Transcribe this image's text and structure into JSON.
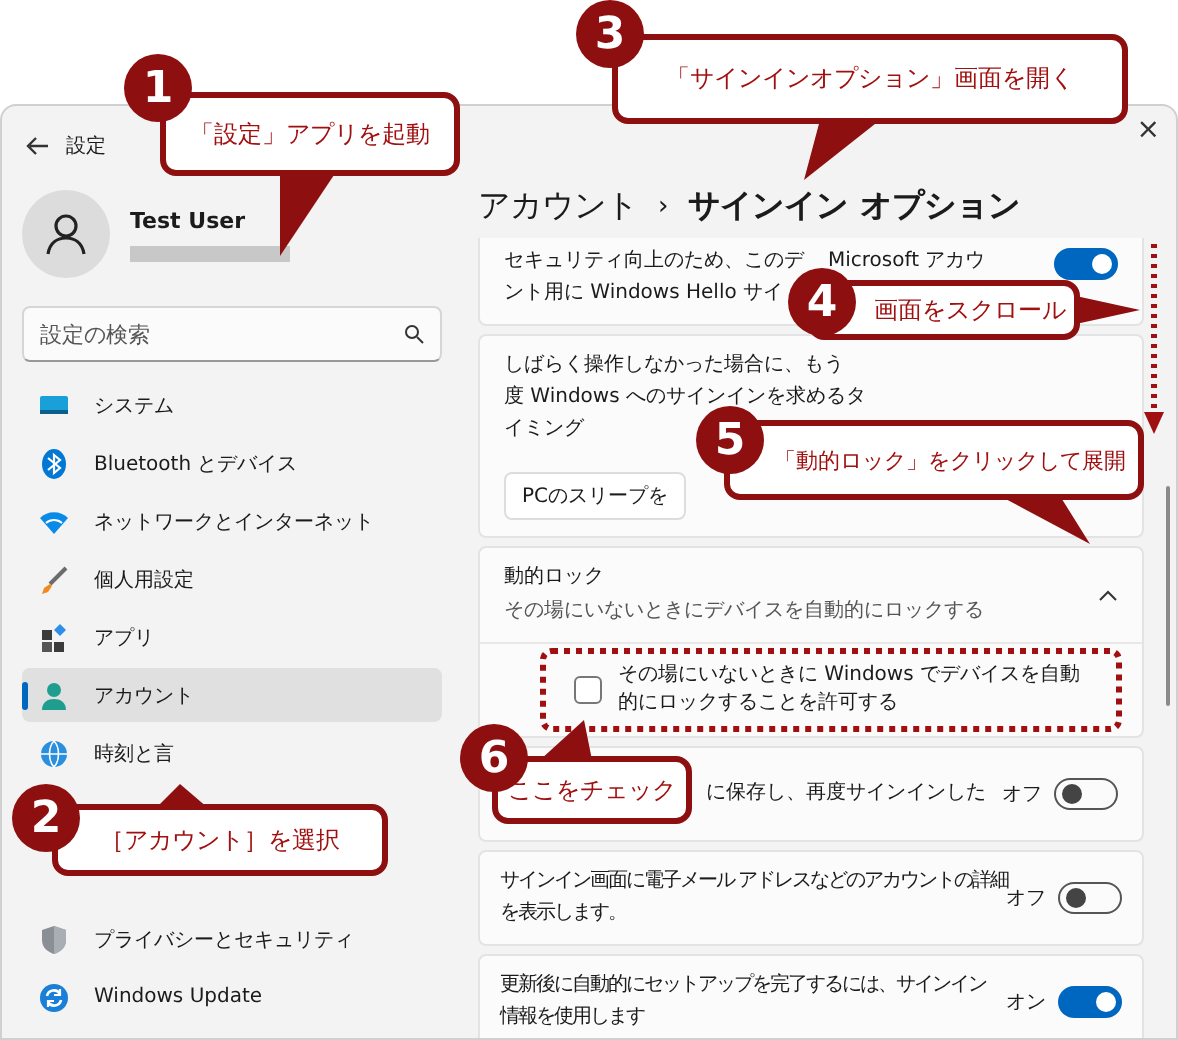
{
  "window": {
    "title": "設定",
    "close": "×"
  },
  "profile": {
    "name": "Test User"
  },
  "search": {
    "placeholder": "設定の検索"
  },
  "nav": [
    {
      "label": "システム",
      "selected": false
    },
    {
      "label": "Bluetooth とデバイス",
      "selected": false
    },
    {
      "label": "ネットワークとインターネット",
      "selected": false
    },
    {
      "label": "個人用設定",
      "selected": false
    },
    {
      "label": "アプリ",
      "selected": false
    },
    {
      "label": "アカウント",
      "selected": true
    },
    {
      "label": "時刻と言",
      "selected": false
    },
    {
      "label": "プライバシーとセキュリティ",
      "selected": false
    },
    {
      "label": "Windows Update",
      "selected": false
    }
  ],
  "breadcrumb": {
    "parent": "アカウント",
    "separator": "›",
    "current": "サインイン オプション"
  },
  "cards": [
    {
      "kind": "toggle",
      "lines": [
        [
          "セキュリティ向上のため、このデ",
          "Microsoft アカウ"
        ],
        [
          "ント用に Windows Hello サイ"
        ]
      ],
      "on": true
    },
    {
      "kind": "dropdown",
      "lines": [
        [
          "しばらく操作しなかった場合に、もう"
        ],
        [
          "度 Windows へのサインインを求めるタ"
        ],
        [
          "イミング"
        ]
      ],
      "value": "PCのスリープを"
    },
    {
      "kind": "expander",
      "title": "動的ロック",
      "subtitle": "その場にいないときにデバイスを自動的にロックする",
      "expanded": true,
      "option": {
        "label": "その場にいないときに Windows でデバイスを自動的にロックすることを許可する",
        "checked": false
      }
    },
    {
      "kind": "toggle",
      "lines": [
        [
          "に保存し、再度サインインした"
        ]
      ],
      "state": "オフ",
      "on": false
    },
    {
      "kind": "toggle",
      "lines": [
        [
          "サインイン画面に電子メール アドレスなどのアカウントの詳細"
        ],
        [
          "を表示します。"
        ]
      ],
      "state": "オフ",
      "on": false
    },
    {
      "kind": "toggle",
      "lines": [
        [
          "更新後に自動的にセットアップを完了するには、サインイン"
        ],
        [
          "情報を使用します"
        ]
      ],
      "state": "オン",
      "on": true
    }
  ],
  "callouts": [
    {
      "number": "1",
      "text": "「設定」アプリを起動"
    },
    {
      "number": "2",
      "text": "［アカウント］を選択"
    },
    {
      "number": "3",
      "text": "「サインインオプション」画面を開く"
    },
    {
      "number": "4",
      "text": "画面をスクロール"
    },
    {
      "number": "5",
      "text": "「動的ロック」をクリックして展開"
    },
    {
      "number": "6",
      "text": "ここをチェック"
    }
  ]
}
